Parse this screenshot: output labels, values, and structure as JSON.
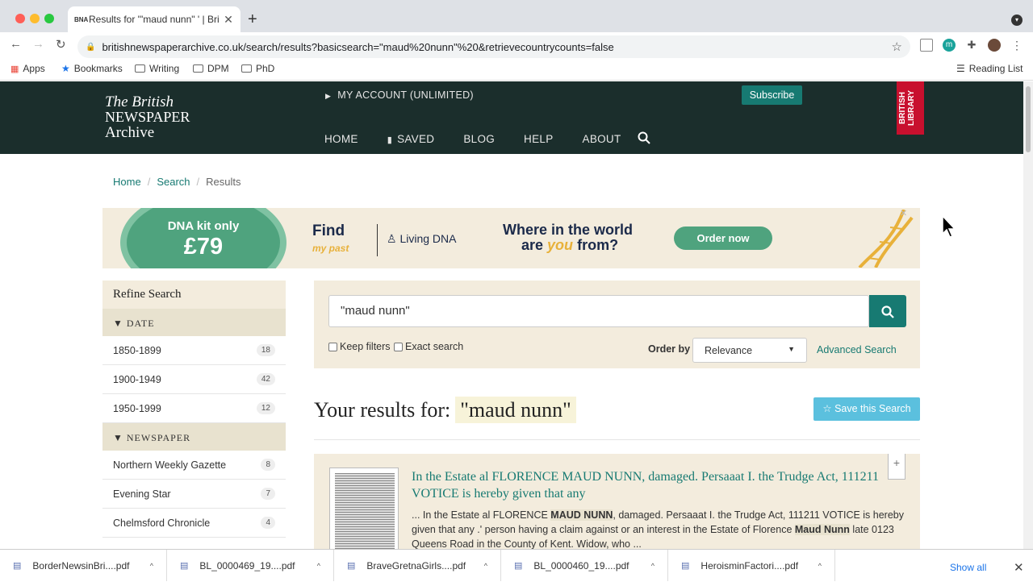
{
  "browser": {
    "tab_title": "Results for '\"maud nunn\" ' | Bri",
    "tab_favicon": "BNA",
    "url": "britishnewspaperarchive.co.uk/search/results?basicsearch=\"maud%20nunn\"%20&retrievecountrycounts=false",
    "bookmarks": {
      "apps": "Apps",
      "bookmarks": "Bookmarks",
      "writing": "Writing",
      "dpm": "DPM",
      "phd": "PhD",
      "reading_list": "Reading List"
    }
  },
  "site": {
    "logo_line1": "The British",
    "logo_line2": "NEWSPAPER",
    "logo_line3": "Archive",
    "account": "MY ACCOUNT (UNLIMITED)",
    "subscribe": "Subscribe",
    "british_library": "BRITISH LIBRARY",
    "nav": [
      "HOME",
      "SAVED",
      "BLOG",
      "HELP",
      "ABOUT"
    ]
  },
  "breadcrumb": {
    "home": "Home",
    "search": "Search",
    "results": "Results"
  },
  "ad": {
    "dna_line1": "DNA kit only",
    "dna_price": "£79",
    "find": "Find",
    "mypast": "my past",
    "living_dna": "Living DNA",
    "q1": "Where in the world",
    "q2a": "are",
    "q2b": "you",
    "q2c": "from?",
    "cta": "Order now"
  },
  "refine": {
    "title": "Refine Search",
    "date_header": "DATE",
    "dates": [
      {
        "label": "1850-1899",
        "count": "18"
      },
      {
        "label": "1900-1949",
        "count": "42"
      },
      {
        "label": "1950-1999",
        "count": "12"
      }
    ],
    "newspaper_header": "NEWSPAPER",
    "newspapers": [
      {
        "label": "Northern Weekly Gazette",
        "count": "8"
      },
      {
        "label": "Evening Star",
        "count": "7"
      },
      {
        "label": "Chelmsford Chronicle",
        "count": "4"
      }
    ]
  },
  "search": {
    "query": "\"maud nunn\"",
    "keep_filters": "Keep filters",
    "exact_search": "Exact search",
    "order_by_label": "Order by",
    "order_by_value": "Relevance",
    "advanced": "Advanced Search"
  },
  "results": {
    "heading": "Your results for:",
    "query": "\"maud nunn\"",
    "save": "Save this Search",
    "items": [
      {
        "title": "In the Estate al FLORENCE MAUD NUNN, damaged. Persaaat I. the Trudge Act, 111211 VOTICE is hereby given that any",
        "snip1": "... In the Estate al FLORENCE ",
        "hl1": "MAUD NUNN",
        "snip2": ", damaged. Persaaat I. the Trudge Act, 111211 VOTICE is hereby given that any .' person having a claim against or an interest in the Estate of Florence ",
        "hl2": "Maud Nunn",
        "snip3": " late 0123 Queens Road in the County of Kent. Widow, who ..."
      }
    ]
  },
  "downloads": {
    "items": [
      "BorderNewsinBri....pdf",
      "BL_0000469_19....pdf",
      "BraveGretnaGirls....pdf",
      "BL_0000460_19....pdf",
      "HeroisminFactori....pdf"
    ],
    "show_all": "Show all"
  },
  "colors": {
    "header": "#1b2e2c",
    "accent": "#177a72",
    "panel": "#f3ecdd",
    "british_library_red": "#c8102e",
    "save_button": "#5bc0de"
  }
}
